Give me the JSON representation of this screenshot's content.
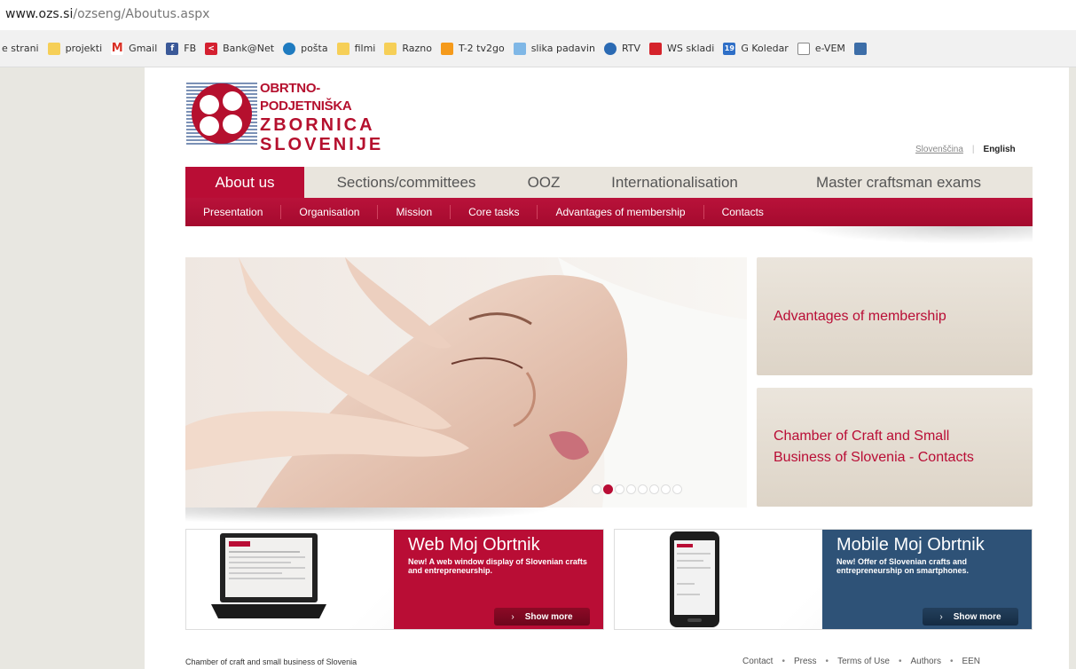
{
  "browser": {
    "url_host": "www.ozs.si",
    "url_path": "/ozseng/Aboutus.aspx",
    "bookmarks": [
      {
        "label": "e strani",
        "icon": "none"
      },
      {
        "label": "projekti",
        "icon": "folder"
      },
      {
        "label": "Gmail",
        "icon": "gmail"
      },
      {
        "label": "FB",
        "icon": "facebook"
      },
      {
        "label": "Bank@Net",
        "icon": "bank"
      },
      {
        "label": "pošta",
        "icon": "posta"
      },
      {
        "label": "filmi",
        "icon": "folder"
      },
      {
        "label": "Razno",
        "icon": "folder"
      },
      {
        "label": "T-2 tv2go",
        "icon": "t2"
      },
      {
        "label": "slika padavin",
        "icon": "rain"
      },
      {
        "label": "RTV",
        "icon": "rtv"
      },
      {
        "label": "WS skladi",
        "icon": "ws"
      },
      {
        "label": "G Koledar",
        "icon": "calendar"
      },
      {
        "label": "e-VEM",
        "icon": "document"
      }
    ]
  },
  "logo": {
    "line1": "OBRTNO-PODJETNIŠKA",
    "line2": "ZBORNICA",
    "line3": "SLOVENIJE"
  },
  "language": {
    "slovenian": "Slovenščina",
    "separator": "|",
    "english": "English"
  },
  "main_nav": [
    "About us",
    "Sections/committees",
    "OOZ",
    "Internationalisation",
    "Master craftsman exams"
  ],
  "sub_nav": [
    "Presentation",
    "Organisation",
    "Mission",
    "Core tasks",
    "Advantages of membership",
    "Contacts"
  ],
  "hero": {
    "slide_count": 8,
    "active_slide": 2
  },
  "side_boxes": [
    "Advantages of membership",
    "Chamber of Craft and Small Business of Slovenia - Contacts"
  ],
  "promos": [
    {
      "title": "Web Moj Obrtnik",
      "description": "New! A web window display of Slovenian crafts and entrepreneurship.",
      "button": "Show more"
    },
    {
      "title": "Mobile Moj Obrtnik",
      "description": "New! Offer of Slovenian crafts and entrepreneurship on smartphones.",
      "button": "Show more"
    }
  ],
  "footer": {
    "left": "Chamber of craft and small business of Slovenia",
    "links": [
      "Contact",
      "Press",
      "Terms of Use",
      "Authors",
      "EEN"
    ]
  },
  "colors": {
    "brand_red": "#b90d35",
    "mobile_blue": "#2e5277",
    "beige": "#e9e5dd"
  }
}
